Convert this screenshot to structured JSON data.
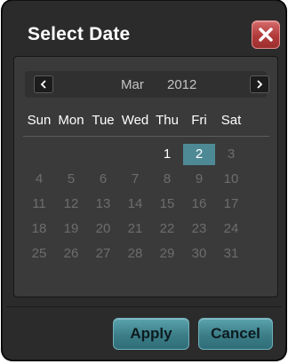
{
  "dialog": {
    "title": "Select Date",
    "close_icon": "close-x-icon"
  },
  "calendar": {
    "month": "Mar",
    "year": "2012",
    "prev_icon": "chevron-left-icon",
    "next_icon": "chevron-right-icon",
    "weekdays": [
      "Sun",
      "Mon",
      "Tue",
      "Wed",
      "Thu",
      "Fri",
      "Sat"
    ],
    "weeks": [
      [
        "",
        "",
        "",
        "",
        "1",
        "2",
        "3"
      ],
      [
        "4",
        "5",
        "6",
        "7",
        "8",
        "9",
        "10"
      ],
      [
        "11",
        "12",
        "13",
        "14",
        "15",
        "16",
        "17"
      ],
      [
        "18",
        "19",
        "20",
        "21",
        "22",
        "23",
        "24"
      ],
      [
        "25",
        "26",
        "27",
        "28",
        "29",
        "30",
        "31"
      ]
    ],
    "selected_day": "2",
    "selection_color": "#4e8a96"
  },
  "actions": {
    "apply_label": "Apply",
    "cancel_label": "Cancel"
  }
}
